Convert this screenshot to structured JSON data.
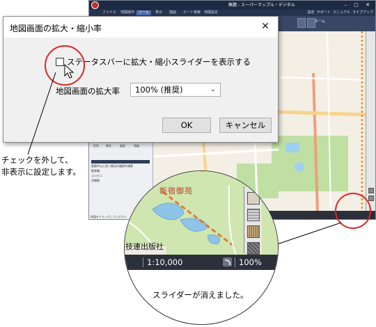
{
  "app": {
    "title": "無題 - スーパーマップル・デジタル",
    "ribbon_tabs": [
      "ファイル",
      "地図操作",
      "ツール",
      "表示",
      "描画",
      "ルート検索",
      "地図設定",
      "その他"
    ],
    "ribbon_right": [
      "設定",
      "サポート",
      "マニュアル",
      "ライブアップ"
    ],
    "ribbon_group": "ホーム",
    "left_panel": {
      "tabs": [
        "住所",
        "駅名",
        "施設",
        "地図"
      ],
      "header": "画面中心に近い周辺の施設を検索",
      "rows": [
        "駐車場",
        "コンビニ",
        "目標物"
      ],
      "footer": "地図をドラッグしてください"
    }
  },
  "dialog": {
    "title": "地図画面の拡大・縮小率",
    "close_label": "✕",
    "checkbox_label": "ステータスバーに拡大・縮小スライダーを表示する",
    "checkbox_checked": false,
    "zoom_label": "地図画面の拡大率",
    "zoom_value": "100% (推奨)",
    "ok_label": "OK",
    "cancel_label": "キャンセル"
  },
  "annotations": {
    "left_note_line1": "チェックを外して、",
    "left_note_line2": "非表示に設定します。",
    "bottom_note": "スライダーが消えました。",
    "highlight_color": "#e02424"
  },
  "magnifier": {
    "park_label": "新宿御苑",
    "org_label": "技連出版社",
    "scale": "1:10,000",
    "zoom_percent": "100%"
  }
}
